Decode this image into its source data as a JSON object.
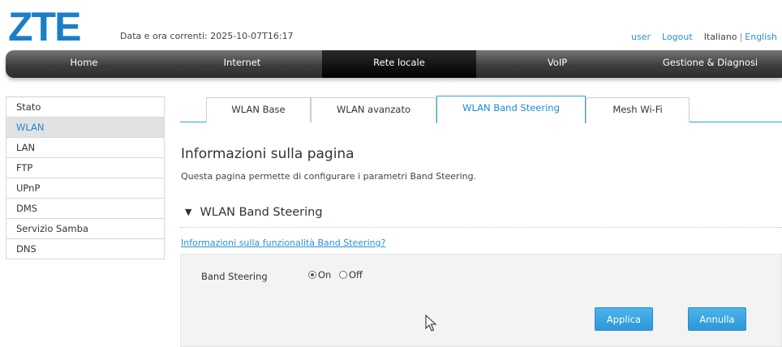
{
  "header": {
    "logo": "ZTE",
    "datetime": "Data e ora correnti: 2025-10-07T16:17",
    "user": "user",
    "logout": "Logout",
    "lang_it": "Italiano",
    "lang_sep": "|",
    "lang_en": "English"
  },
  "nav": [
    {
      "label": "Home"
    },
    {
      "label": "Internet"
    },
    {
      "label": "Rete locale",
      "active": true
    },
    {
      "label": "VoIP"
    },
    {
      "label": "Gestione & Diagnosi"
    }
  ],
  "sidebar": [
    {
      "label": "Stato"
    },
    {
      "label": "WLAN",
      "active": true
    },
    {
      "label": "LAN"
    },
    {
      "label": "FTP"
    },
    {
      "label": "UPnP"
    },
    {
      "label": "DMS"
    },
    {
      "label": "Servizio Samba"
    },
    {
      "label": "DNS"
    }
  ],
  "tabs": [
    {
      "label": "WLAN Base"
    },
    {
      "label": "WLAN avanzato"
    },
    {
      "label": "WLAN Band Steering",
      "active": true
    },
    {
      "label": "Mesh Wi-Fi"
    }
  ],
  "main": {
    "title": "Informazioni sulla pagina",
    "description": "Questa pagina permette di configurare i parametri Band Steering.",
    "section_title": "WLAN Band Steering",
    "info_link": "Informazioni sulla funzionalità Band Steering?",
    "field_label": "Band Steering",
    "option_on": "On",
    "option_off": "Off",
    "selected": "On",
    "apply": "Applica",
    "cancel": "Annulla"
  },
  "colors": {
    "brand": "#1a7fc7",
    "accent": "#2ba6d9",
    "button": "#2c98d8"
  },
  "icons": {
    "section_toggle": "triangle-down-icon",
    "cursor": "mouse-pointer-icon"
  }
}
